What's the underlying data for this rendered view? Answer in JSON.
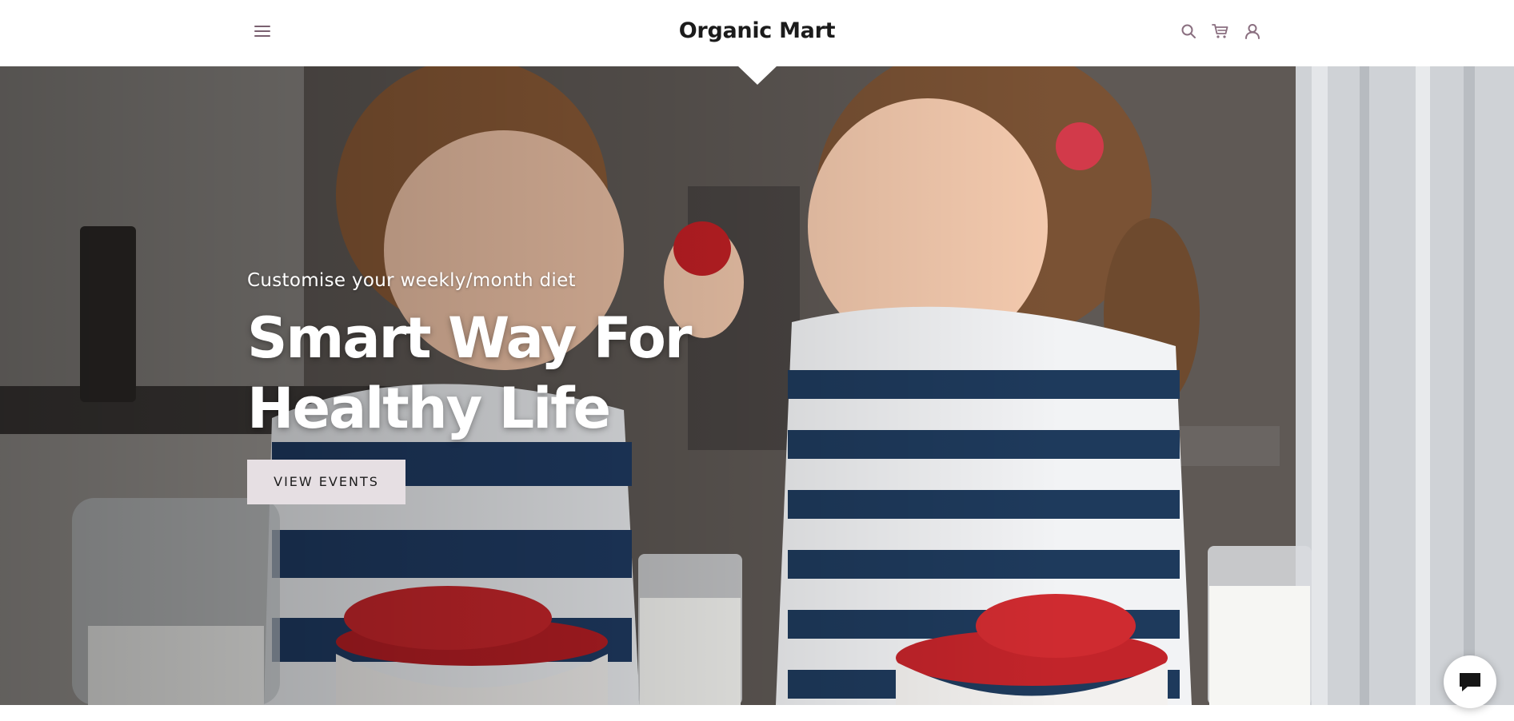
{
  "header": {
    "brand": "Organic Mart",
    "menu_icon": "hamburger-menu-icon",
    "icons": [
      "search-icon",
      "cart-icon",
      "account-icon"
    ]
  },
  "hero": {
    "subtitle": "Customise your weekly/month diet",
    "title_line1": "Smart Way For",
    "title_line2": "Healthy Life",
    "cta_label": "VIEW EVENTS",
    "image_description": "Two children in striped shirts sharing strawberries beside bowls of strawberries and glasses of milk"
  },
  "chat": {
    "icon": "chat-bubble-icon"
  },
  "colors": {
    "header_bg": "#ffffff",
    "icon_color": "#8a6f80",
    "cta_bg": "#e6dfe3",
    "text_on_hero": "#ffffff",
    "brand_text": "#1b1b1b"
  }
}
